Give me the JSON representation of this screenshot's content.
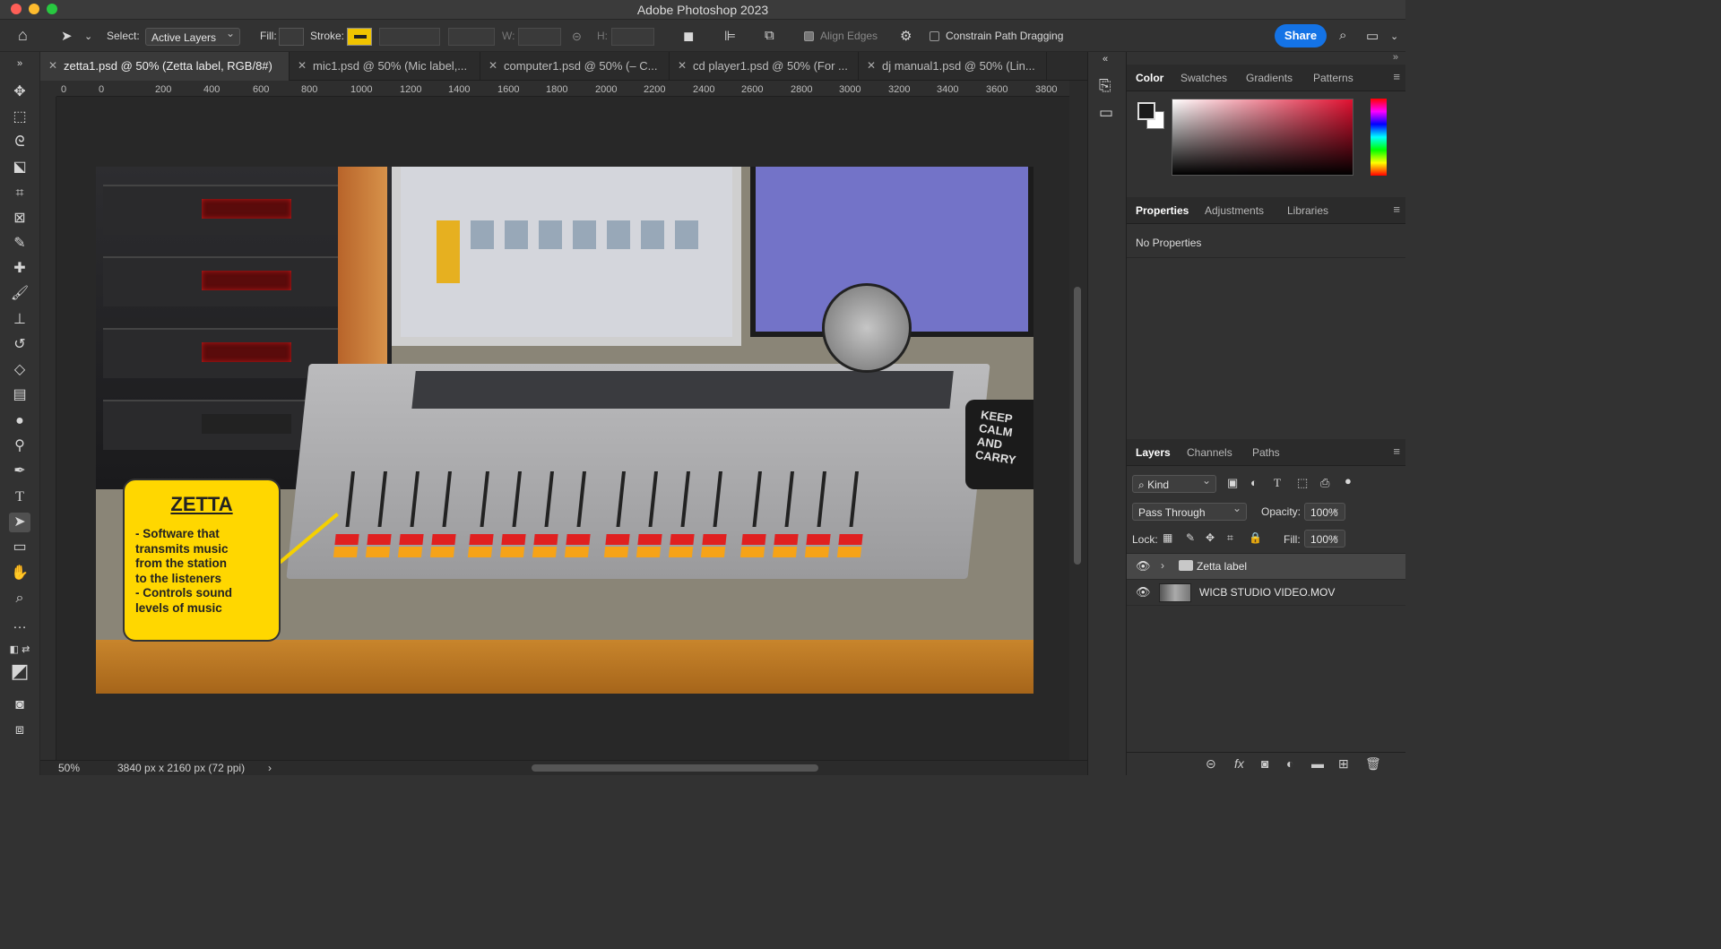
{
  "window": {
    "title": "Adobe Photoshop 2023"
  },
  "options": {
    "select_label": "Select:",
    "select_value": "Active Layers",
    "fill_label": "Fill:",
    "stroke_label": "Stroke:",
    "w_label": "W:",
    "h_label": "H:",
    "align_edges": "Align Edges",
    "constrain": "Constrain Path Dragging",
    "share": "Share"
  },
  "tabs": [
    {
      "label": "zetta1.psd @ 50% (Zetta label, RGB/8#)"
    },
    {
      "label": "mic1.psd @ 50% (Mic label,..."
    },
    {
      "label": "computer1.psd @ 50% (– C..."
    },
    {
      "label": "cd player1.psd @ 50% (For ..."
    },
    {
      "label": "dj manual1.psd @ 50% (Lin..."
    }
  ],
  "ruler_h": [
    "0",
    "0",
    "200",
    "400",
    "600",
    "800",
    "1000",
    "1200",
    "1400",
    "1600",
    "1800",
    "2000",
    "2200",
    "2400",
    "2600",
    "2800",
    "3000",
    "3200",
    "3400",
    "3600",
    "3800"
  ],
  "canvas": {
    "label_title": "ZETTA",
    "label_body": "- Software that\ntransmits music\nfrom the station\nto the listeners\n- Controls sound\nlevels of music",
    "mug_text": "KEEP\nCALM\nAND\nCARRY"
  },
  "status": {
    "zoom": "50%",
    "dimensions": "3840 px x 2160 px (72 ppi)"
  },
  "color_panel": {
    "tabs": [
      "Color",
      "Swatches",
      "Gradients",
      "Patterns"
    ]
  },
  "properties_panel": {
    "tabs": [
      "Properties",
      "Adjustments",
      "Libraries"
    ],
    "empty": "No Properties"
  },
  "layers_panel": {
    "tabs": [
      "Layers",
      "Channels",
      "Paths"
    ],
    "filter": "Kind",
    "blend": "Pass Through",
    "opacity_label": "Opacity:",
    "opacity": "100%",
    "lock_label": "Lock:",
    "fill_label": "Fill:",
    "fill": "100%",
    "layers": [
      {
        "name": "Zetta label",
        "type": "group"
      },
      {
        "name": "WICB STUDIO VIDEO.MOV",
        "type": "video"
      }
    ]
  },
  "colors": {
    "accent": "#1473e6",
    "label_yellow": "#ffd700",
    "panel_bg": "#323232"
  }
}
